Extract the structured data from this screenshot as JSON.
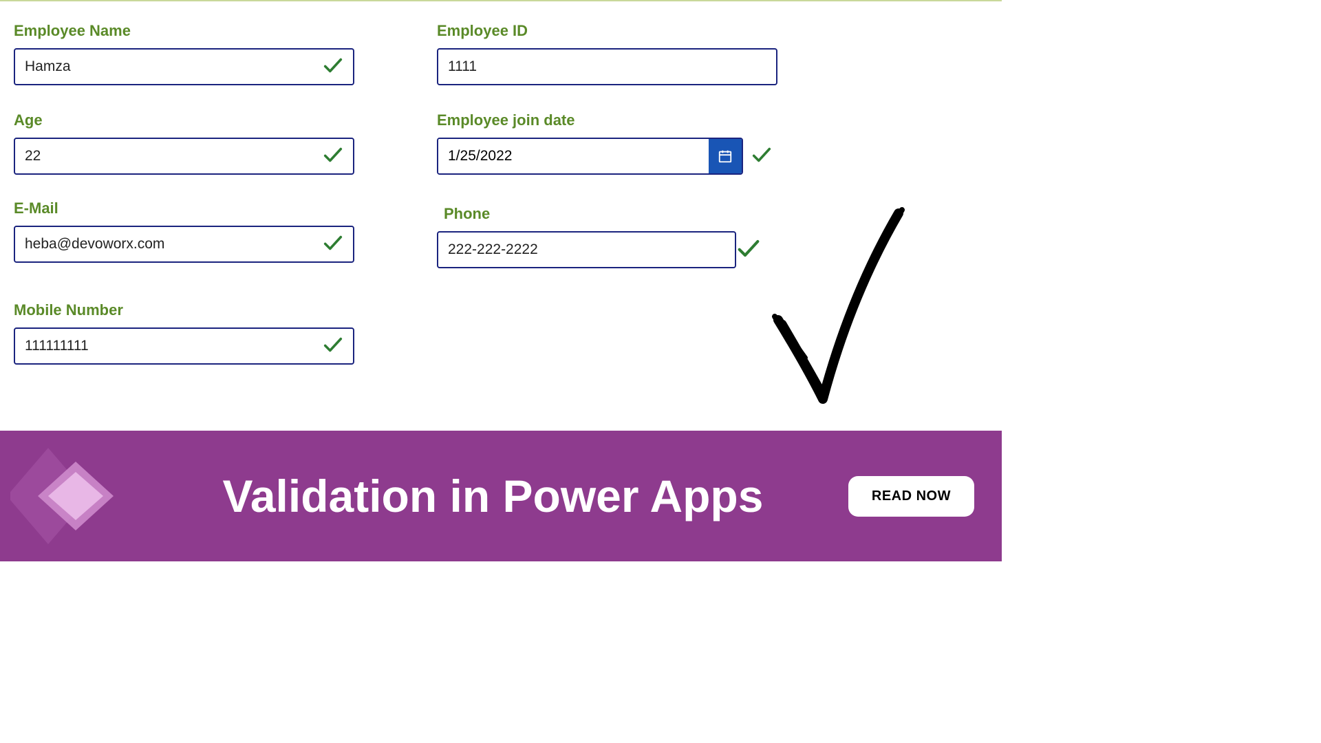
{
  "form": {
    "left": [
      {
        "label": "Employee Name",
        "value": "Hamza",
        "checkInside": true
      },
      {
        "label": "Age",
        "value": "22",
        "checkInside": true
      },
      {
        "label": "E-Mail",
        "value": "heba@devoworx.com",
        "checkInside": true
      },
      {
        "label": "Mobile Number",
        "value": "111111111",
        "checkInside": true
      }
    ],
    "right": {
      "employee_id": {
        "label": "Employee  ID",
        "value": "1111"
      },
      "join_date": {
        "label": "Employee join date",
        "value": "1/25/2022"
      },
      "phone": {
        "label": "Phone",
        "value": "222-222-2222"
      }
    }
  },
  "banner": {
    "title": "Validation in Power Apps",
    "button": "READ NOW"
  },
  "colors": {
    "accent": "#8e3b8e",
    "label": "#5a8a28",
    "border": "#1a237e",
    "check": "#2e7d32"
  }
}
